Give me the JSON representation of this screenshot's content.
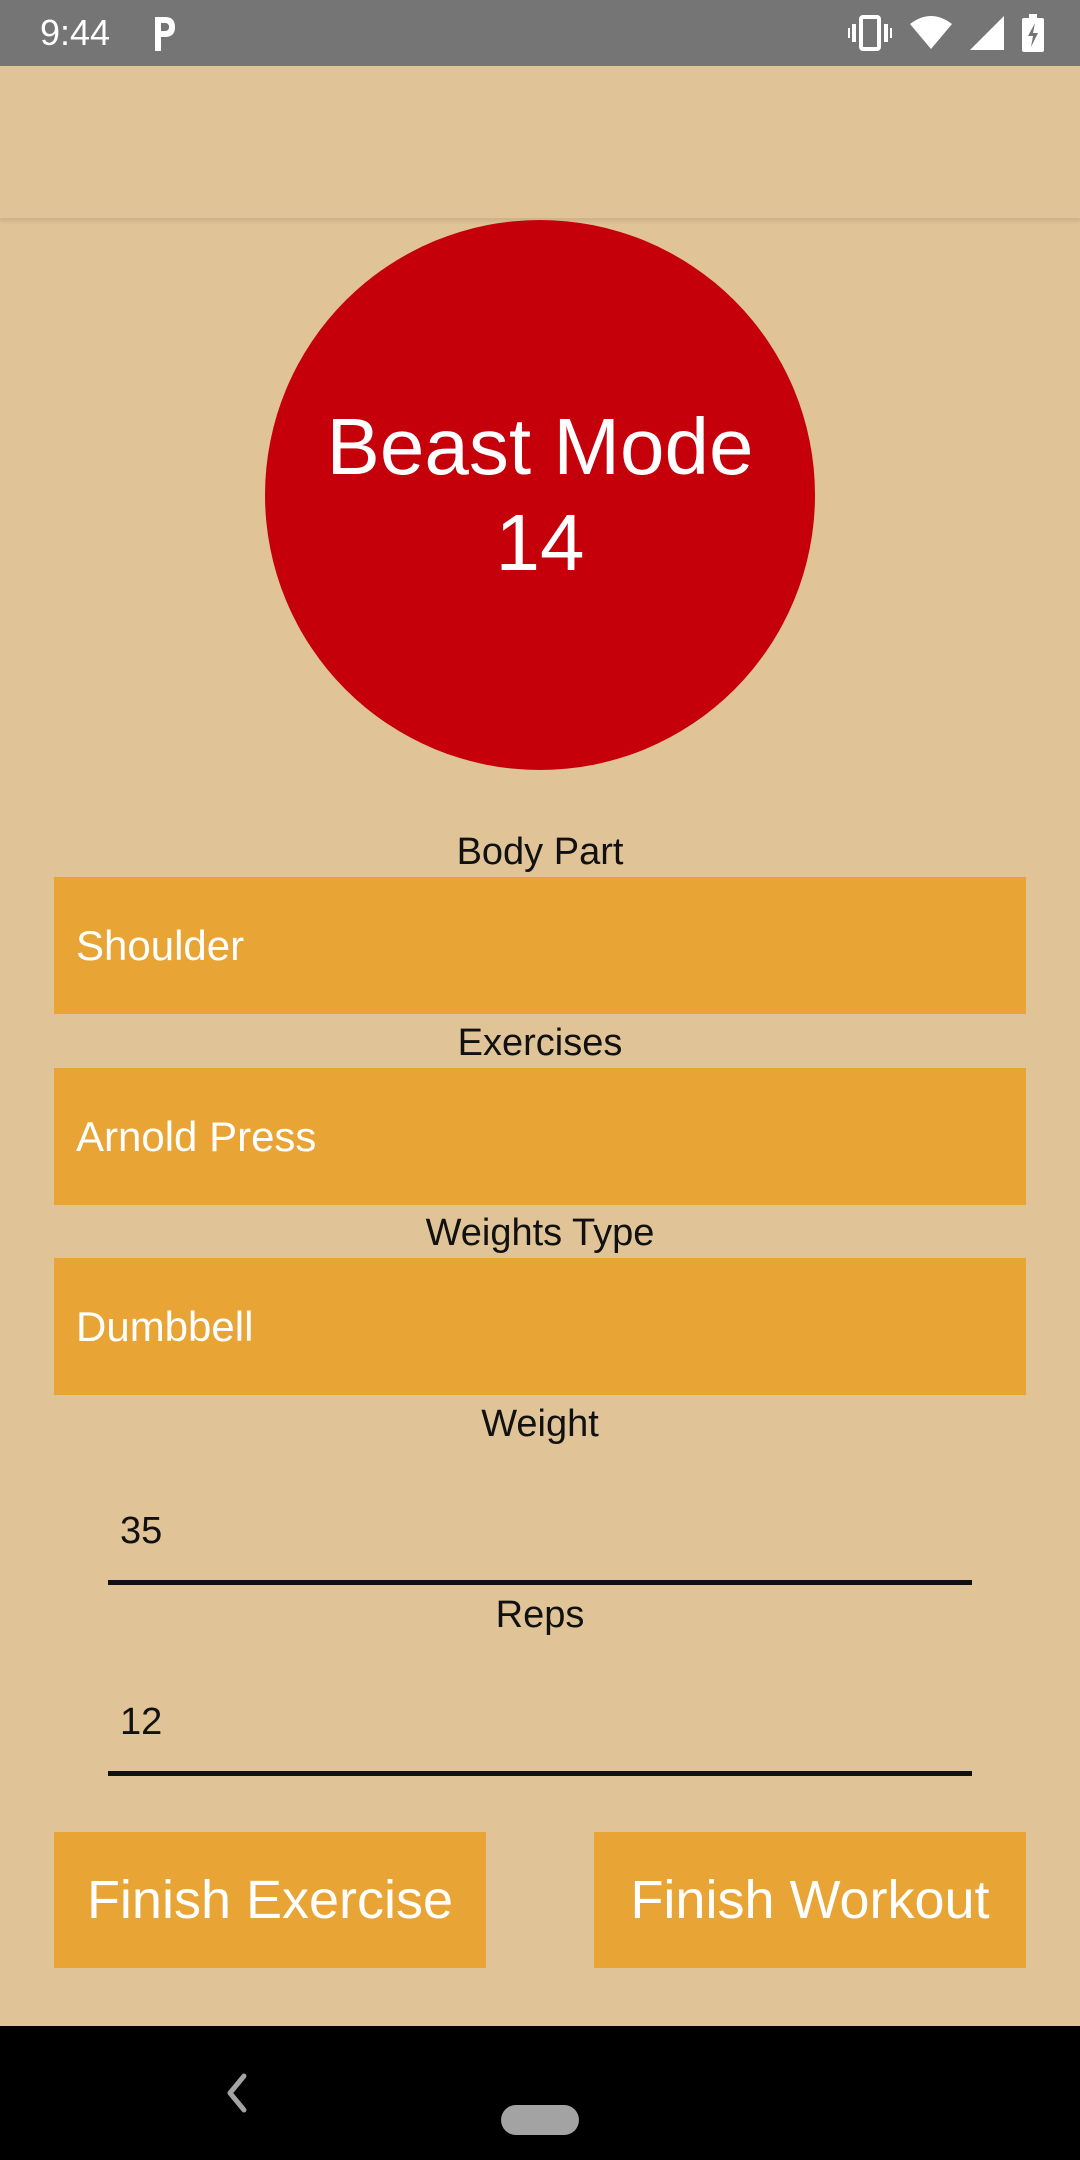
{
  "status_bar": {
    "time": "9:44",
    "notification_icon": "parking-icon",
    "icons": [
      "vibrate-icon",
      "wifi-icon",
      "signal-icon",
      "battery-charging-icon"
    ]
  },
  "counter": {
    "label": "Beast Mode",
    "value": "14",
    "color": "#c5000b"
  },
  "body_part": {
    "label": "Body Part",
    "selected": "Shoulder"
  },
  "exercises": {
    "label": "Exercises",
    "selected": "Arnold Press"
  },
  "weights_type": {
    "label": "Weights Type",
    "selected": "Dumbbell"
  },
  "weight": {
    "label": "Weight",
    "value": "35"
  },
  "reps": {
    "label": "Reps",
    "value": "12"
  },
  "actions": {
    "finish_exercise": "Finish Exercise",
    "finish_workout": "Finish Workout"
  },
  "colors": {
    "background": "#e0c498",
    "accent": "#e8a535",
    "counter": "#c5000b"
  },
  "nav_bar": {
    "icons": [
      "back-icon",
      "home-pill-icon"
    ]
  }
}
